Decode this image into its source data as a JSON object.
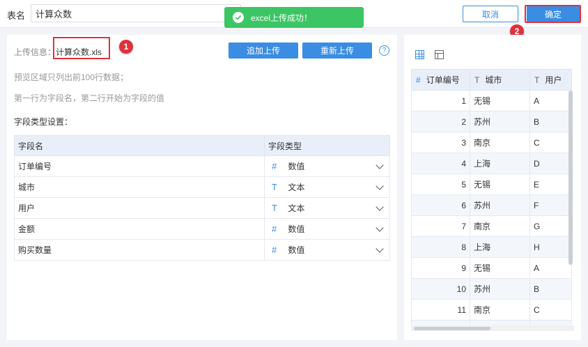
{
  "header": {
    "table_name_label": "表名",
    "table_name_value": "计算众数",
    "cancel_label": "取消",
    "confirm_label": "确定"
  },
  "toast": {
    "message": "excel上传成功！"
  },
  "upload": {
    "info_label": "上传信息：",
    "file_name": "计算众数.xls",
    "append_label": "追加上传",
    "reupload_label": "重新上传",
    "help_symbol": "?"
  },
  "notes": {
    "preview_note": "预览区域只列出前100行数据；",
    "row_note": "第一行为字段名，第二行开始为字段的值",
    "field_settings_title": "字段类型设置："
  },
  "annotations": {
    "badge1": "1",
    "badge2": "2"
  },
  "field_table": {
    "headers": [
      "字段名",
      "字段类型"
    ],
    "rows": [
      {
        "name": "订单编号",
        "type": "数值",
        "icon": "#",
        "icon_name": "number-type-icon"
      },
      {
        "name": "城市",
        "type": "文本",
        "icon": "T",
        "icon_name": "text-type-icon"
      },
      {
        "name": "用户",
        "type": "文本",
        "icon": "T",
        "icon_name": "text-type-icon"
      },
      {
        "name": "金额",
        "type": "数值",
        "icon": "#",
        "icon_name": "number-type-icon"
      },
      {
        "name": "购买数量",
        "type": "数值",
        "icon": "#",
        "icon_name": "number-type-icon"
      }
    ]
  },
  "preview": {
    "headers": [
      {
        "icon": "#",
        "label": "订单编号"
      },
      {
        "icon": "T",
        "label": "城市"
      },
      {
        "icon": "T",
        "label": "用户"
      }
    ],
    "rows": [
      [
        "1",
        "无锡",
        "A"
      ],
      [
        "2",
        "苏州",
        "B"
      ],
      [
        "3",
        "南京",
        "C"
      ],
      [
        "4",
        "上海",
        "D"
      ],
      [
        "5",
        "无锡",
        "E"
      ],
      [
        "6",
        "苏州",
        "F"
      ],
      [
        "7",
        "南京",
        "G"
      ],
      [
        "8",
        "上海",
        "H"
      ],
      [
        "9",
        "无锡",
        "A"
      ],
      [
        "10",
        "苏州",
        "B"
      ],
      [
        "11",
        "南京",
        "C"
      ],
      [
        "",
        "",
        ""
      ]
    ]
  },
  "colors": {
    "accent": "#3a8de2",
    "success": "#3cc564",
    "highlight": "#e0323c"
  }
}
